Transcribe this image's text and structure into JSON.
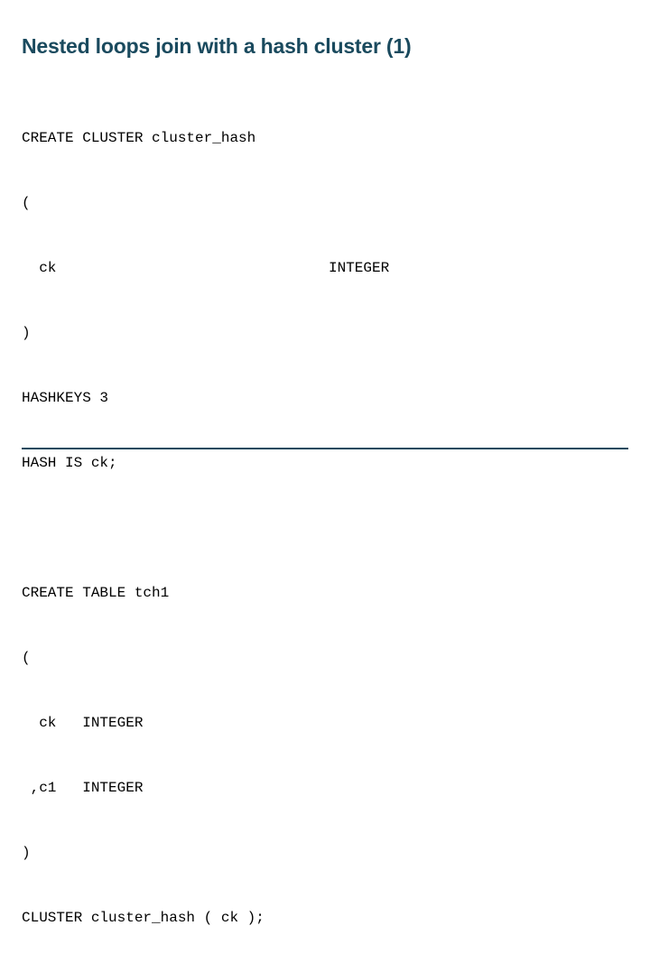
{
  "title": "Nested loops join with a hash cluster (1)",
  "code1": {
    "line1": "CREATE CLUSTER cluster_hash",
    "line2": "(",
    "line3_label": "  ck",
    "line3_type": "INTEGER",
    "line4": ")",
    "line5": "HASHKEYS 3",
    "line6": "HASH IS ck;"
  },
  "code2": {
    "line1": "CREATE TABLE tch1",
    "line2": "(",
    "line3": "  ck   INTEGER",
    "line4": " ,c1   INTEGER",
    "line5": ")",
    "line6": "CLUSTER cluster_hash ( ck );"
  }
}
